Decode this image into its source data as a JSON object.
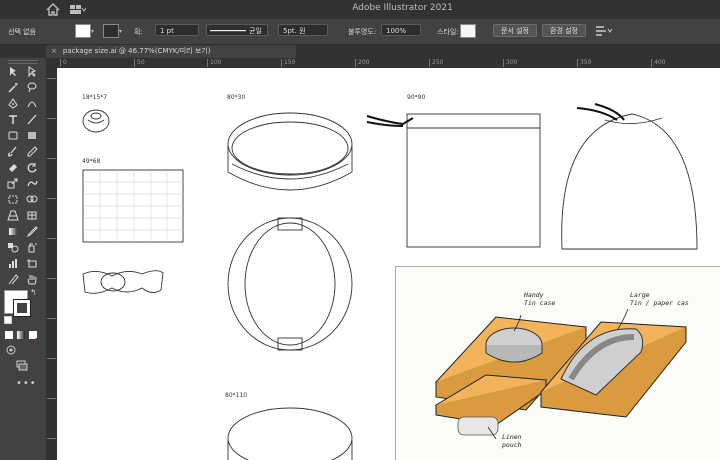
{
  "app": {
    "title": "Adobe Illustrator 2021"
  },
  "control_bar": {
    "selection_label": "선택 없음",
    "stroke_label": "획:",
    "stroke_value": "1 pt",
    "line_style_label": "균일",
    "brush_label": "5pt. 원",
    "opacity_label": "불투명도:",
    "opacity_value": "100%",
    "style_label": "스타일:",
    "doc_setup_button": "문서 설정",
    "preferences_button": "환경 설정"
  },
  "document_tab": {
    "name": "package size.ai @ 46.77%(CMYK/미리 보기)"
  },
  "ruler": {
    "h_ticks": [
      "0",
      "50",
      "100",
      "150",
      "200",
      "250",
      "300",
      "350",
      "400"
    ]
  },
  "artboard_labels": {
    "ball": "18*15*7",
    "flat_box": "49*68",
    "round_tin": "80*30",
    "pouch_flat": "90*90",
    "round_tin_bottom": "80*110"
  },
  "sketch_notes": {
    "handy": [
      "Handy",
      "Tin case"
    ],
    "large": [
      "Large",
      "Tin / paper cas"
    ],
    "linen": [
      "Linen",
      "pouch"
    ]
  },
  "colors": {
    "kraft": "#f2b35b",
    "kraft_dark": "#d99a40",
    "tin": "#cfcfcf"
  }
}
